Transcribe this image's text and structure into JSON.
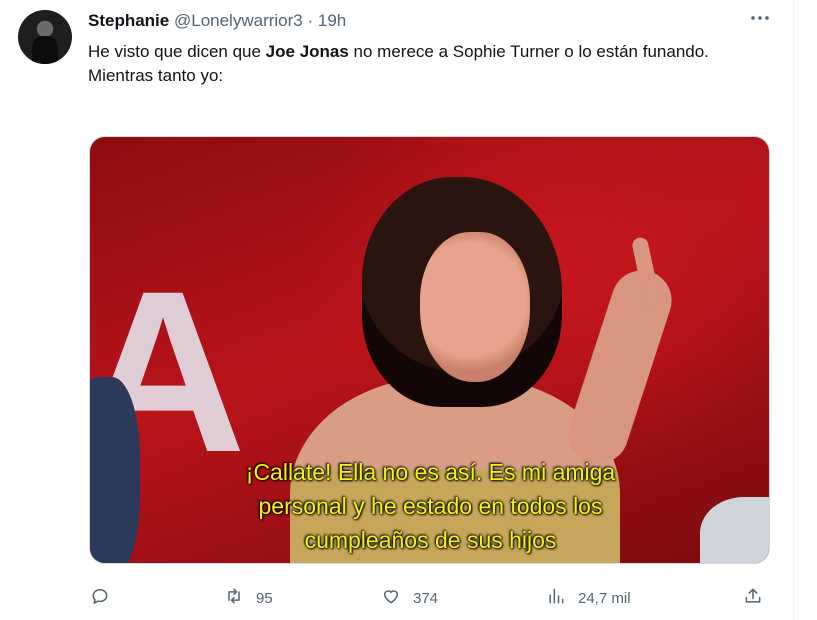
{
  "tweet": {
    "author_name": "Stephanie",
    "handle": "@Lonelywarrior3",
    "separator": "·",
    "time": "19h",
    "text_line1_before": "He visto que dicen que ",
    "text_line1_bold": "Joe Jonas",
    "text_line1_after": " no merece a Sophie Turner o lo están funando.",
    "text_line2": "Mientras tanto yo:",
    "media": {
      "caption_line1": "¡Callate! Ella no es así. Es mi amiga",
      "caption_line2": "personal y he estado en todos los",
      "caption_line3": "cumpleaños de sus hijos",
      "background_letter": "A"
    },
    "stats": {
      "replies": "",
      "retweets": "95",
      "likes": "374",
      "views": "24,7 mil"
    }
  },
  "icons": {
    "more": "more-icon",
    "reply": "reply-icon",
    "retweet": "retweet-icon",
    "like": "like-icon",
    "views": "views-icon",
    "share": "share-icon"
  },
  "colors": {
    "text_primary": "#0f1419",
    "text_secondary": "#536471",
    "caption": "#f3f31a"
  }
}
